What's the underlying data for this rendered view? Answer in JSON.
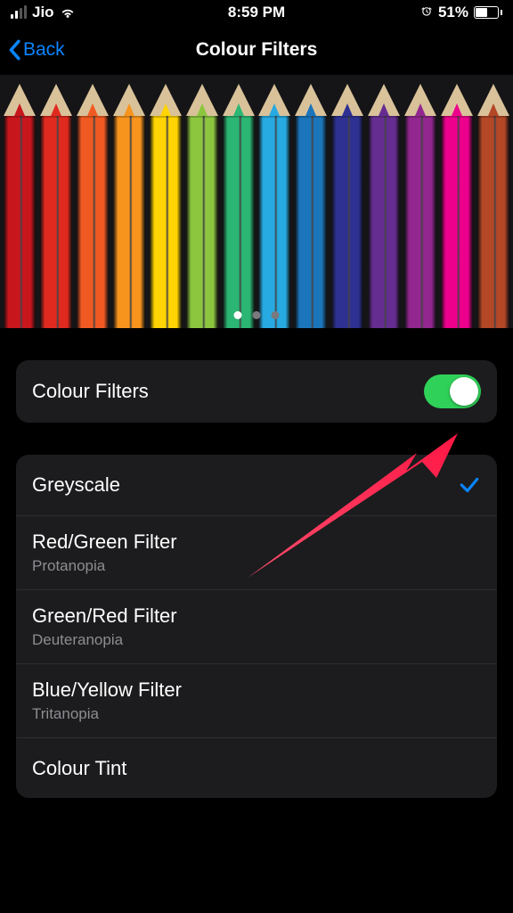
{
  "statusbar": {
    "carrier": "Jio",
    "time": "8:59 PM",
    "battery_pct": "51%"
  },
  "nav": {
    "back_label": "Back",
    "title": "Colour Filters"
  },
  "preview": {
    "page_count": 3,
    "active_page": 0,
    "pencil_colors": [
      "#c8161d",
      "#e12a1f",
      "#f05a22",
      "#f7941d",
      "#ffd400",
      "#8cc63f",
      "#2bb673",
      "#27a9e1",
      "#1b75bb",
      "#2e3192",
      "#662d91",
      "#92278f",
      "#ec008c",
      "#b34726"
    ]
  },
  "toggle_row": {
    "label": "Colour Filters",
    "on": true
  },
  "options": [
    {
      "label": "Greyscale",
      "sub": "",
      "selected": true
    },
    {
      "label": "Red/Green Filter",
      "sub": "Protanopia",
      "selected": false
    },
    {
      "label": "Green/Red Filter",
      "sub": "Deuteranopia",
      "selected": false
    },
    {
      "label": "Blue/Yellow Filter",
      "sub": "Tritanopia",
      "selected": false
    },
    {
      "label": "Colour Tint",
      "sub": "",
      "selected": false
    }
  ],
  "annotation": {
    "arrow_color": "#ff2d55"
  }
}
